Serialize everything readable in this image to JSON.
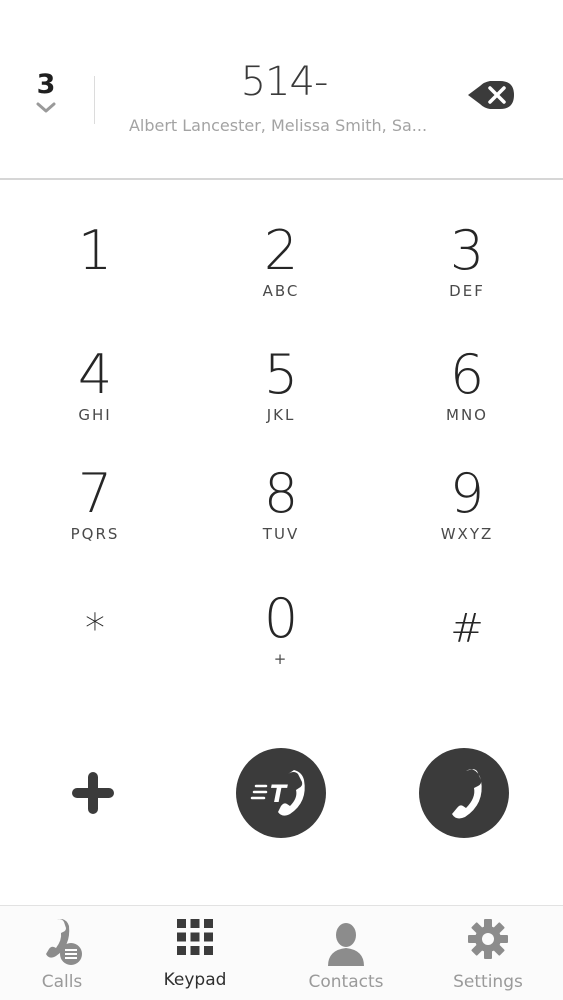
{
  "header": {
    "match_count": "3",
    "dialed_number": "514-",
    "matches_text": "Albert Lancester, Melissa Smith, Sa..."
  },
  "keypad": {
    "keys": [
      {
        "digit": "1",
        "letters": ""
      },
      {
        "digit": "2",
        "letters": "ABC"
      },
      {
        "digit": "3",
        "letters": "DEF"
      },
      {
        "digit": "4",
        "letters": "GHI"
      },
      {
        "digit": "5",
        "letters": "JKL"
      },
      {
        "digit": "6",
        "letters": "MNO"
      },
      {
        "digit": "7",
        "letters": "PQRS"
      },
      {
        "digit": "8",
        "letters": "TUV"
      },
      {
        "digit": "9",
        "letters": "WXYZ"
      },
      {
        "digit": "*",
        "letters": ""
      },
      {
        "digit": "0",
        "letters": "+"
      },
      {
        "digit": "#",
        "letters": ""
      }
    ]
  },
  "actions": {
    "icons": [
      "plus-icon",
      "text-call-icon",
      "phone-icon"
    ],
    "button_color": "#3b3b3b"
  },
  "tabbar": {
    "tabs": [
      {
        "label": "Calls",
        "icon": "calls-icon"
      },
      {
        "label": "Keypad",
        "icon": "keypad-grid-icon"
      },
      {
        "label": "Contacts",
        "icon": "contact-person-icon"
      },
      {
        "label": "Settings",
        "icon": "gear-icon"
      }
    ],
    "active": "Keypad"
  },
  "colors": {
    "background": "#ffffff",
    "text_dark": "#262626",
    "text_muted": "#a3a3a3",
    "icon_gray": "#8c8c8c",
    "icon_dark": "#3b3b3b"
  }
}
